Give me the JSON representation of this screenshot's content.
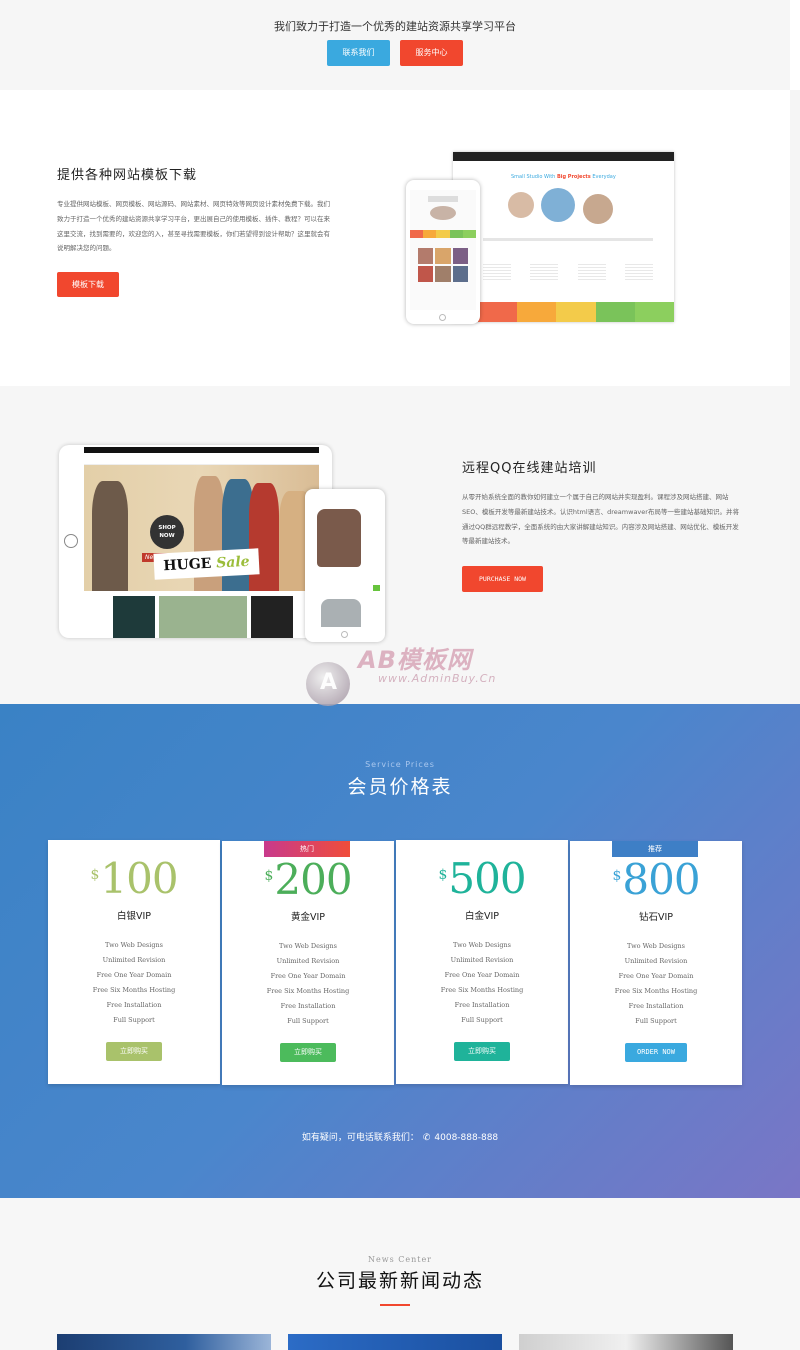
{
  "top": {
    "slogan": "我们致力于打造一个优秀的建站资源共享学习平台",
    "btn_contact": "联系我们",
    "btn_service": "服务中心"
  },
  "section1": {
    "title": "提供各种网站模板下载",
    "desc": "专业提供网站模板、网页模板、网站源码、网站素材、网页特效等网页设计素材免费下载。我们致力于打造一个优秀的建站资源共享学习平台，更出展自己的使用模板、插件、教程？可以在来这里交流，找到需要的，欢迎您的入，甚至寻找需要模板，你们若望得到设计帮助？这里就会有说明解决您的问题。",
    "button": "模板下载",
    "mock_head_a": "Small Studio With",
    "mock_head_b": "Big Projects",
    "mock_head_c": "Everyday",
    "stat_colors": [
      "#f0694a",
      "#f7a93b",
      "#f3cb4a",
      "#7ac35a",
      "#8ccf5e"
    ]
  },
  "section2": {
    "title": "远程QQ在线建站培训",
    "desc": "从零开始系统全面的教你如何建立一个属于自己的网站并实现盈利。课程涉及网站搭建、网站SEO、模板开发等最新建站技术。认识html语言、dreamwaver布局等一些建站基础知识。并将通过QQ群远程教学，全面系统的由大家讲解建站知识。内容涉及网站搭建、网站优化、模板开发等最新建站技术。",
    "button": "PURCHASE NOW",
    "badge": "SHOP NOW",
    "sale_a": "HUGE",
    "sale_b": "Sale",
    "new_years": "New Years"
  },
  "watermark": {
    "logo_letter": "A",
    "big": "AB模板网",
    "small": "www.AdminBuy.Cn"
  },
  "pricing": {
    "subtitle": "Service Prices",
    "title": "会员价格表",
    "cards": [
      {
        "tag": "",
        "currency": "$",
        "price": "100",
        "name": "白银VIP",
        "color": "#a9c26b",
        "button": "立即购买",
        "btn_color": "#a9c26b",
        "features": [
          "Two Web Designs",
          "Unlimited Revision",
          "Free One Year Domain",
          "Free Six Months Hosting",
          "Free Installation",
          "Full Support"
        ]
      },
      {
        "tag": "热门",
        "currency": "$",
        "price": "200",
        "name": "黄金VIP",
        "color": "#4cae5a",
        "button": "立即购买",
        "btn_color": "#4cbb5c",
        "tag_color": "#e0356b",
        "features": [
          "Two Web Designs",
          "Unlimited Revision",
          "Free One Year Domain",
          "Free Six Months Hosting",
          "Free Installation",
          "Full Support"
        ]
      },
      {
        "tag": "",
        "currency": "$",
        "price": "500",
        "name": "白金VIP",
        "color": "#1fb39a",
        "button": "立即购买",
        "btn_color": "#1fb39a",
        "features": [
          "Two Web Designs",
          "Unlimited Revision",
          "Free One Year Domain",
          "Free Six Months Hosting",
          "Free Installation",
          "Full Support"
        ]
      },
      {
        "tag": "推荐",
        "currency": "$",
        "price": "800",
        "name": "钻石VIP",
        "color": "#3aa2d6",
        "button": "ORDER NOW",
        "btn_color": "#3aa9df",
        "tag_color": "#3e7fc6",
        "features": [
          "Two Web Designs",
          "Unlimited Revision",
          "Free One Year Domain",
          "Free Six Months Hosting",
          "Free Installation",
          "Full Support"
        ]
      }
    ],
    "contact_prefix": "如有疑问，可电话联系我们：",
    "contact_phone": "4008-888-888"
  },
  "news": {
    "subtitle": "News Center",
    "title": "公司最新新闻动态"
  }
}
